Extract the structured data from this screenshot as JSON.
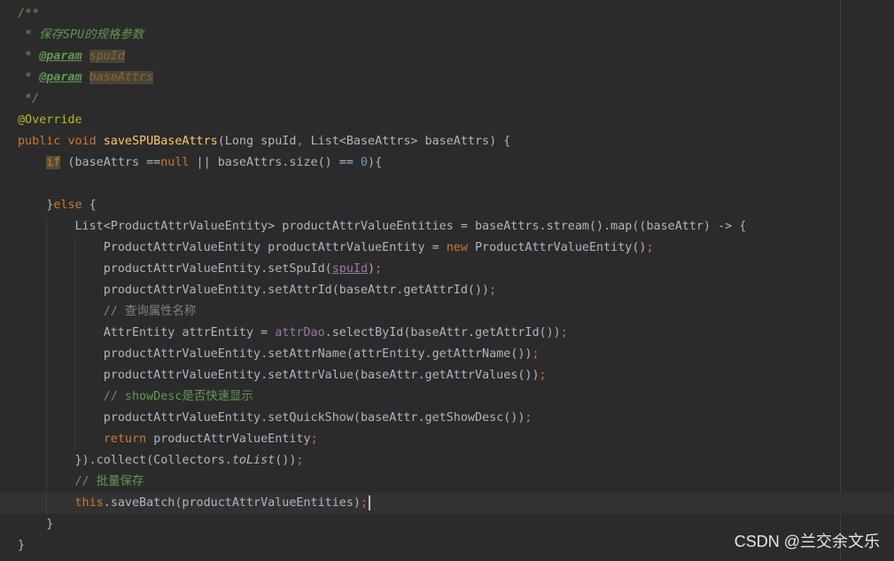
{
  "editor": {
    "lines": [
      {
        "tokens": [
          {
            "t": "/**",
            "c": "cm"
          }
        ]
      },
      {
        "tokens": [
          {
            "t": " * 保存SPU的规格参数",
            "c": "cm"
          }
        ]
      },
      {
        "tokens": [
          {
            "t": " * ",
            "c": "cm"
          },
          {
            "t": "@param",
            "c": "cmtag"
          },
          {
            "t": " ",
            "c": "cm"
          },
          {
            "t": "spuId",
            "c": "cmparam"
          }
        ]
      },
      {
        "tokens": [
          {
            "t": " * ",
            "c": "cm"
          },
          {
            "t": "@param",
            "c": "cmtag"
          },
          {
            "t": " ",
            "c": "cm"
          },
          {
            "t": "baseAttrs",
            "c": "cmparam"
          }
        ]
      },
      {
        "tokens": [
          {
            "t": " */",
            "c": "cm"
          }
        ]
      },
      {
        "tokens": [
          {
            "t": "@Override",
            "c": "ann"
          }
        ]
      },
      {
        "tokens": [
          {
            "t": "public ",
            "c": "kw"
          },
          {
            "t": "void ",
            "c": "kw"
          },
          {
            "t": "saveSPUBaseAttrs",
            "c": "fn"
          },
          {
            "t": "(Long spuId",
            "c": ""
          },
          {
            "t": ", ",
            "c": "kw"
          },
          {
            "t": "List<BaseAttrs> baseAttrs) {",
            "c": ""
          }
        ]
      },
      {
        "tokens": [
          {
            "t": "    ",
            "c": ""
          },
          {
            "t": "if",
            "c": "kw hl"
          },
          {
            "t": " (baseAttrs ==",
            "c": ""
          },
          {
            "t": "null",
            "c": "kw"
          },
          {
            "t": " || baseAttrs.size() == ",
            "c": ""
          },
          {
            "t": "0",
            "c": "num"
          },
          {
            "t": "){",
            "c": ""
          }
        ]
      },
      {
        "tokens": []
      },
      {
        "tokens": [
          {
            "t": "    }",
            "c": ""
          },
          {
            "t": "else",
            "c": "kw"
          },
          {
            "t": " {",
            "c": ""
          }
        ]
      },
      {
        "tokens": [
          {
            "t": "        List<ProductAttrValueEntity> productAttrValueEntities = baseAttrs.stream().map((baseAttr) -> {",
            "c": ""
          }
        ]
      },
      {
        "tokens": [
          {
            "t": "            ProductAttrValueEntity productAttrValueEntity = ",
            "c": ""
          },
          {
            "t": "new ",
            "c": "kw"
          },
          {
            "t": "ProductAttrValueEntity()",
            "c": ""
          },
          {
            "t": ";",
            "c": "kw"
          }
        ]
      },
      {
        "tokens": [
          {
            "t": "            productAttrValueEntity.setSpuId(",
            "c": ""
          },
          {
            "t": "spuId",
            "c": "fld under"
          },
          {
            "t": ")",
            "c": ""
          },
          {
            "t": ";",
            "c": "kw"
          }
        ]
      },
      {
        "tokens": [
          {
            "t": "            productAttrValueEntity.setAttrId(baseAttr.getAttrId())",
            "c": ""
          },
          {
            "t": ";",
            "c": "kw"
          }
        ]
      },
      {
        "tokens": [
          {
            "t": "            ",
            "c": ""
          },
          {
            "t": "// 查询属性名称",
            "c": "lc"
          }
        ]
      },
      {
        "tokens": [
          {
            "t": "            AttrEntity attrEntity = ",
            "c": ""
          },
          {
            "t": "attrDao",
            "c": "fld"
          },
          {
            "t": ".selectById(baseAttr.getAttrId())",
            "c": ""
          },
          {
            "t": ";",
            "c": "kw"
          }
        ]
      },
      {
        "tokens": [
          {
            "t": "            productAttrValueEntity.setAttrName(attrEntity.getAttrName())",
            "c": ""
          },
          {
            "t": ";",
            "c": "kw"
          }
        ]
      },
      {
        "tokens": [
          {
            "t": "            productAttrValueEntity.setAttrValue(baseAttr.getAttrValues())",
            "c": ""
          },
          {
            "t": ";",
            "c": "kw"
          }
        ]
      },
      {
        "tokens": [
          {
            "t": "            ",
            "c": ""
          },
          {
            "t": "// showDesc是否快速显示",
            "c": "lcg"
          }
        ]
      },
      {
        "tokens": [
          {
            "t": "            productAttrValueEntity.setQuickShow(baseAttr.getShowDesc())",
            "c": ""
          },
          {
            "t": ";",
            "c": "kw"
          }
        ]
      },
      {
        "tokens": [
          {
            "t": "            ",
            "c": ""
          },
          {
            "t": "return ",
            "c": "kw"
          },
          {
            "t": "productAttrValueEntity",
            "c": ""
          },
          {
            "t": ";",
            "c": "kw"
          }
        ]
      },
      {
        "tokens": [
          {
            "t": "        }).collect(Collectors.",
            "c": ""
          },
          {
            "t": "toList",
            "c": "st"
          },
          {
            "t": "())",
            "c": ""
          },
          {
            "t": ";",
            "c": "kw"
          }
        ]
      },
      {
        "tokens": [
          {
            "t": "        ",
            "c": ""
          },
          {
            "t": "// 批量保存",
            "c": "lcg"
          }
        ]
      },
      {
        "current": true,
        "tokens": [
          {
            "t": "        ",
            "c": ""
          },
          {
            "t": "this",
            "c": "kw"
          },
          {
            "t": ".saveBatch(productAttrValueEntities)",
            "c": ""
          },
          {
            "t": ";",
            "c": "kw"
          }
        ]
      },
      {
        "tokens": [
          {
            "t": "    }",
            "c": ""
          }
        ]
      },
      {
        "tokens": [
          {
            "t": "}",
            "c": ""
          }
        ]
      }
    ]
  },
  "watermark": {
    "text": "CSDN @兰交余文乐"
  }
}
